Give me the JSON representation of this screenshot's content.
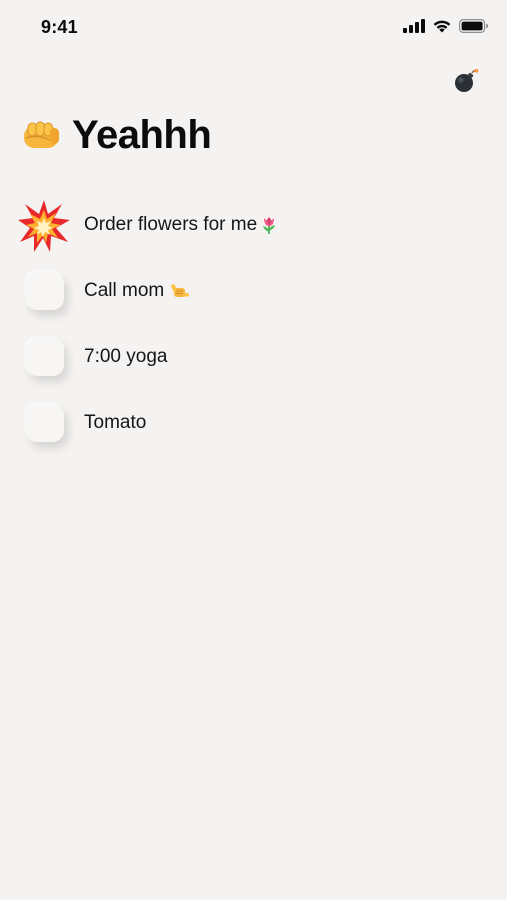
{
  "status_bar": {
    "time": "9:41",
    "icons": [
      "cellular-signal-icon",
      "wifi-icon",
      "battery-icon"
    ]
  },
  "top_action": {
    "icon": "bomb-icon"
  },
  "header": {
    "icon": "fist-icon",
    "title": "Yeahhh"
  },
  "tasks": [
    {
      "label": "Order flowers for me",
      "emoji": "tulip-icon",
      "done": true
    },
    {
      "label": "Call mom",
      "emoji": "call-me-hand-icon",
      "done": false
    },
    {
      "label": "7:00 yoga",
      "emoji": "",
      "done": false
    },
    {
      "label": "Tomato",
      "emoji": "",
      "done": false
    }
  ],
  "colors": {
    "background": "#f5f3f1",
    "text": "#141414",
    "checkbox": "#f7f6f4"
  }
}
